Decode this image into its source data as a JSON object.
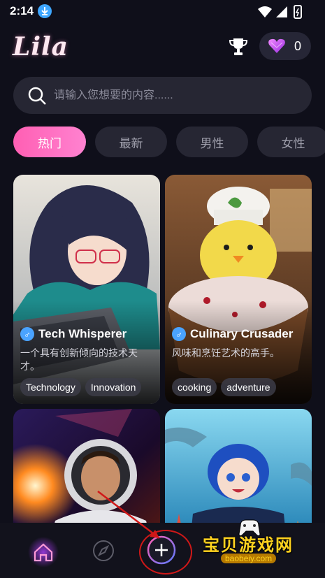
{
  "status": {
    "time": "2:14"
  },
  "header": {
    "logo": "Lila",
    "gem_count": "0"
  },
  "search": {
    "placeholder": "请输入您想要的内容......"
  },
  "tabs": [
    {
      "label": "热门",
      "active": true
    },
    {
      "label": "最新"
    },
    {
      "label": "男性"
    },
    {
      "label": "女性"
    }
  ],
  "cards": [
    {
      "title": "Tech Whisperer",
      "desc": "一个具有创新倾向的技术天才。",
      "tags": [
        "Technology",
        "Innovation"
      ]
    },
    {
      "title": "Culinary Crusader",
      "desc": "风味和烹饪艺术的高手。",
      "tags": [
        "cooking",
        "adventure"
      ]
    },
    {
      "title": "",
      "desc": "",
      "tags": []
    },
    {
      "title": "",
      "desc": "",
      "tags": []
    }
  ],
  "watermark": {
    "text": "宝贝游戏网",
    "url": "baobeiy.com"
  },
  "colors": {
    "accent_pink": "#ff5fb3",
    "background": "#0f0f1a",
    "annotation_red": "#d01818"
  }
}
